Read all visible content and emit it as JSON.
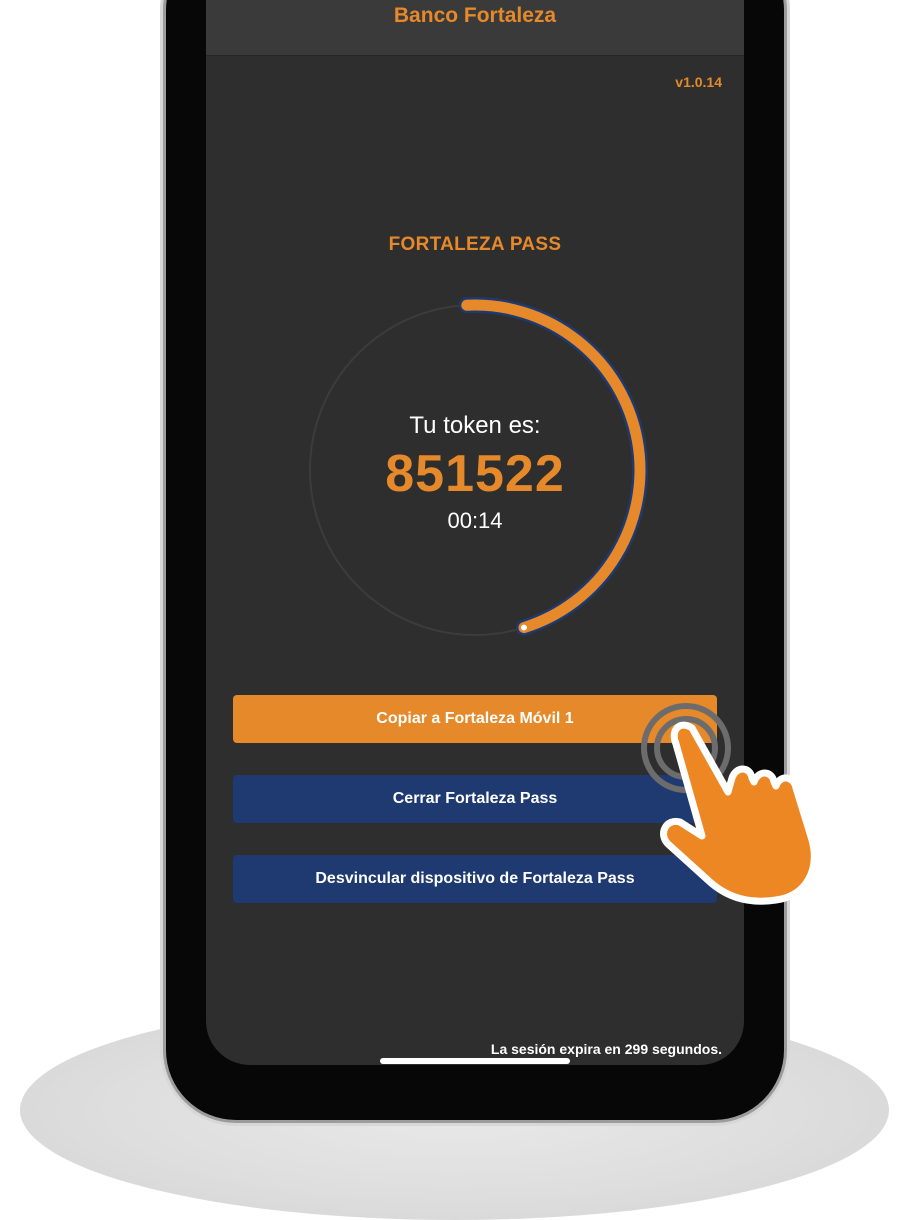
{
  "app": {
    "title": "Banco Fortaleza",
    "version": "v1.0.14"
  },
  "token": {
    "section_title": "FORTALEZA PASS",
    "label": "Tu token es:",
    "value": "851522",
    "countdown": "00:14",
    "progress_fraction": 0.46
  },
  "buttons": {
    "copy": "Copiar a Fortaleza Móvil 1",
    "close": "Cerrar Fortaleza Pass",
    "unlink": "Desvincular dispositivo de Fortaleza Pass"
  },
  "session_message": "La sesión expira en 299 segundos.",
  "colors": {
    "accent_orange": "#e5892a",
    "button_blue": "#1e3a70",
    "screen_background": "#2e2e2e"
  },
  "icons": {
    "pointer": "tap-hand-icon"
  }
}
